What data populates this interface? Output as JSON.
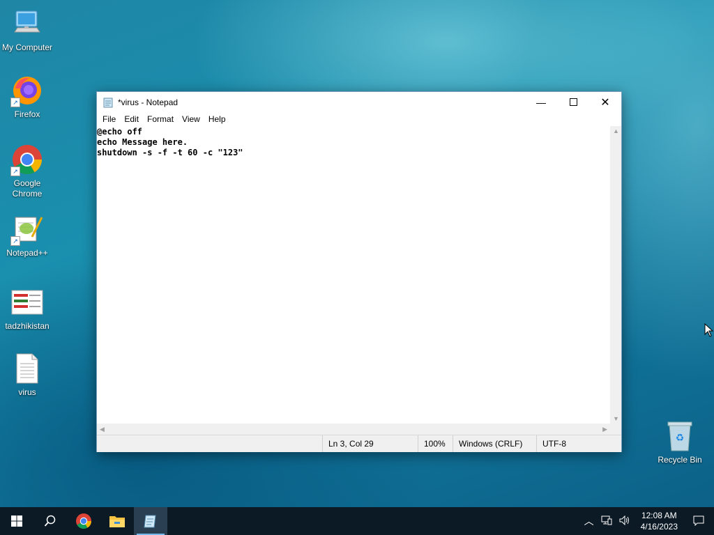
{
  "desktop": {
    "icons": [
      {
        "label": "My Computer"
      },
      {
        "label": "Firefox"
      },
      {
        "label": "Google Chrome"
      },
      {
        "label": "Notepad++"
      },
      {
        "label": "tadzhikistan"
      },
      {
        "label": "virus"
      },
      {
        "label": "Recycle Bin"
      }
    ]
  },
  "notepad": {
    "title": "*virus - Notepad",
    "menu": [
      "File",
      "Edit",
      "Format",
      "View",
      "Help"
    ],
    "content": "@echo off\necho Message here.\nshutdown -s -f -t 60 -c \"123\"",
    "status": {
      "position": "Ln 3, Col 29",
      "zoom": "100%",
      "line_endings": "Windows (CRLF)",
      "encoding": "UTF-8"
    }
  },
  "taskbar": {
    "clock_time": "12:08 AM",
    "clock_date": "4/16/2023"
  },
  "colors": {
    "taskbar_bg": "#0c1a26",
    "accent": "#76b9ed"
  }
}
